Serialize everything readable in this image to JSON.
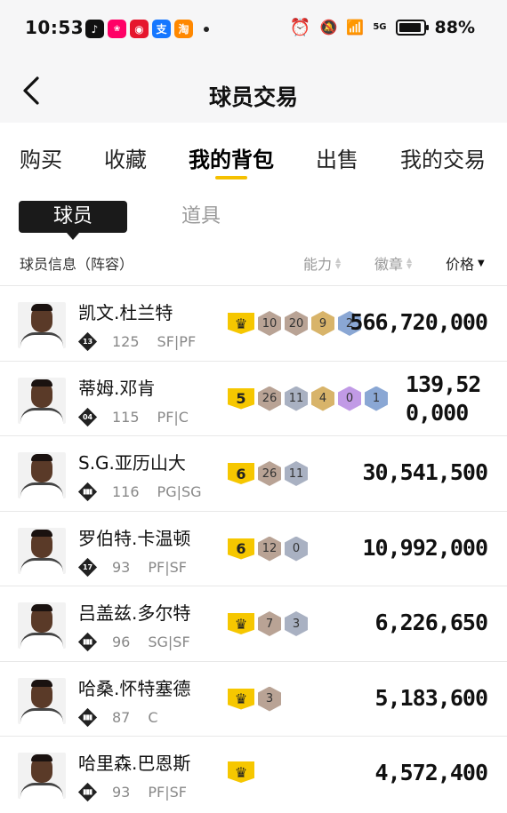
{
  "status_bar": {
    "time": "10:53",
    "battery": "88%",
    "network": "5G"
  },
  "header": {
    "title": "球员交易"
  },
  "tabs": [
    {
      "label": "购买",
      "active": false
    },
    {
      "label": "收藏",
      "active": false
    },
    {
      "label": "我的背包",
      "active": true
    },
    {
      "label": "出售",
      "active": false
    },
    {
      "label": "我的交易",
      "active": false
    }
  ],
  "segments": {
    "active": "球员",
    "inactive": "道具"
  },
  "columns": {
    "info": "球员信息（阵容）",
    "ability": "能力",
    "badge": "徽章",
    "price": "价格"
  },
  "players": [
    {
      "name": "凯文.杜兰特",
      "jersey": "13",
      "rating": "125",
      "positions": "SF|PF",
      "tier": "crown",
      "badges": [
        [
          "bronze",
          "10"
        ],
        [
          "bronze",
          "20"
        ],
        [
          "gold",
          "9"
        ],
        [
          "blue",
          "2"
        ]
      ],
      "price": "566,720,000"
    },
    {
      "name": "蒂姆.邓肯",
      "jersey": "04",
      "rating": "115",
      "positions": "PF|C",
      "tier": "5",
      "badges": [
        [
          "bronze",
          "26"
        ],
        [
          "silver",
          "11"
        ],
        [
          "gold",
          "4"
        ],
        [
          "purple",
          "0"
        ],
        [
          "blue",
          "1"
        ]
      ],
      "price": "139,520,000"
    },
    {
      "name": "S.G.亚历山大",
      "jersey": "",
      "rating": "116",
      "positions": "PG|SG",
      "tier": "6",
      "badges": [
        [
          "bronze",
          "26"
        ],
        [
          "silver",
          "11"
        ]
      ],
      "price": "30,541,500"
    },
    {
      "name": "罗伯特.卡温顿",
      "jersey": "17",
      "rating": "93",
      "positions": "PF|SF",
      "tier": "6",
      "badges": [
        [
          "bronze",
          "12"
        ],
        [
          "silver",
          "0"
        ]
      ],
      "price": "10,992,000"
    },
    {
      "name": "吕盖兹.多尔特",
      "jersey": "",
      "rating": "96",
      "positions": "SG|SF",
      "tier": "crown",
      "badges": [
        [
          "bronze",
          "7"
        ],
        [
          "silver",
          "3"
        ]
      ],
      "price": "6,226,650"
    },
    {
      "name": "哈桑.怀特塞德",
      "jersey": "",
      "rating": "87",
      "positions": "C",
      "tier": "crown",
      "badges": [
        [
          "bronze",
          "3"
        ]
      ],
      "price": "5,183,600"
    },
    {
      "name": "哈里森.巴恩斯",
      "jersey": "",
      "rating": "93",
      "positions": "PF|SF",
      "tier": "crown",
      "badges": [],
      "price": "4,572,400"
    }
  ],
  "colors": {
    "accent": "#f5c000",
    "tier_yellow": "#f6c700"
  }
}
